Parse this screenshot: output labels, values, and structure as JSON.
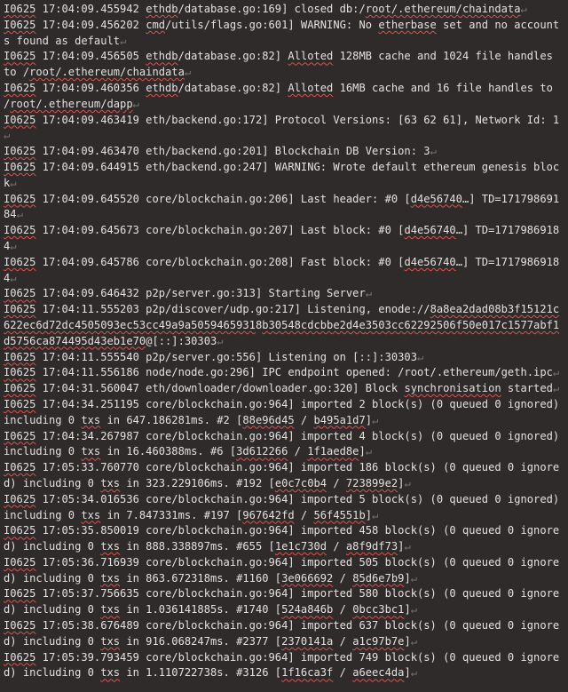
{
  "paragraph_marker": "↵",
  "line_break_marker": "↵",
  "underline_tokens": [
    "I0625",
    "ethdb",
    "cmd",
    "etherbase",
    "Alloted",
    "root/.ethereum/chaindata",
    "root/.ethereum/dapp",
    "d4e56740",
    "8a8ea2dad08b3f15121c622ec6d72dc4505093ec53cc49a9a5059465931",
    "b30548cdcbbe2d4e",
    "3503cc62292506f50e017c1577abf1d5756ca874495d43eb1e70",
    "synchronisation",
    "txs",
    "88e96d45",
    "b495a1d7",
    "3d612266",
    "1f1aed8e",
    "e0c7c0b4",
    "723899e2",
    "967642fd",
    "56f4551b",
    "1e1c730d",
    "a8f9df73",
    "3e066692",
    "85d6e7b9",
    "524a846b",
    "0bcc3bc1",
    "2370141a",
    "a1c97b7e",
    "1f16ca3f",
    "a6eec4da"
  ],
  "lines": [
    {
      "text": "I0625 17:04:09.455942 ethdb/database.go:169] closed db:/root/.ethereum/chaindata",
      "pmark": true
    },
    {
      "text": "I0625 17:04:09.456202 cmd/utils/flags.go:601] WARNING: No etherbase set and no accounts found as default",
      "pmark": true
    },
    {
      "text": "I0625 17:04:09.456505 ethdb/database.go:82] Alloted 128MB cache and 1024 file handles to /root/.ethereum/chaindata",
      "pmark": true
    },
    {
      "text": "I0625 17:04:09.460356 ethdb/database.go:82] Alloted 16MB cache and 16 file handles to /root/.ethereum/dapp",
      "pmark": true
    },
    {
      "text": "I0625 17:04:09.463419 eth/backend.go:172] Protocol Versions: [63 62 61], Network Id: 1",
      "pmark": true
    },
    {
      "text": "I0625 17:04:09.463470 eth/backend.go:201] Blockchain DB Version: 3",
      "pmark": true
    },
    {
      "text": "I0625 17:04:09.644915 eth/backend.go:247] WARNING: Wrote default ethereum genesis block",
      "pmark": true
    },
    {
      "text": "I0625 17:04:09.645520 core/blockchain.go:206] Last header: #0 [d4e56740…] TD=17179869184",
      "pmark": true
    },
    {
      "text": "I0625 17:04:09.645673 core/blockchain.go:207] Last block: #0 [d4e56740…] TD=17179869184",
      "pmark": true
    },
    {
      "text": "I0625 17:04:09.645786 core/blockchain.go:208] Fast block: #0 [d4e56740…] TD=17179869184",
      "pmark": true
    },
    {
      "text": "I0625 17:04:09.646432 p2p/server.go:313] Starting Server",
      "pmark": true
    },
    {
      "text": "I0625 17:04:11.555203 p2p/discover/udp.go:217] Listening, enode://8a8ea2dad08b3f15121c622ec6d72dc4505093ec53cc49a9a50594659318b30548cdcbbe2d4e3503cc62292506f50e017c1577abf1d5756ca874495d43eb1e70@[::]:30303",
      "pmark": true
    },
    {
      "text": "I0625 17:04:11.555540 p2p/server.go:556] Listening on [::]:30303",
      "pmark": true
    },
    {
      "text": "I0625 17:04:11.556186 node/node.go:296] IPC endpoint opened: /root/.ethereum/geth.ipc",
      "pmark": true
    },
    {
      "text": "I0625 17:04:31.560047 eth/downloader/downloader.go:320] Block synchronisation started",
      "pmark": true
    },
    {
      "text": "I0625 17:04:34.251195 core/blockchain.go:964] imported 2 block(s) (0 queued 0 ignored) including 0 txs in 647.186281ms. #2 [88e96d45 / b495a1d7]",
      "pmark": true
    },
    {
      "text": "I0625 17:04:34.267987 core/blockchain.go:964] imported 4 block(s) (0 queued 0 ignored) including 0 txs in 16.460388ms. #6 [3d612266 / 1f1aed8e]",
      "pmark": true
    },
    {
      "text": "I0625 17:05:33.760770 core/blockchain.go:964] imported 186 block(s) (0 queued 0 ignored) including 0 txs in 323.229106ms. #192 [e0c7c0b4 / 723899e2]",
      "pmark": true
    },
    {
      "text": "I0625 17:05:34.016536 core/blockchain.go:964] imported 5 block(s) (0 queued 0 ignored) including 0 txs in 7.847331ms. #197 [967642fd / 56f4551b]",
      "pmark": true
    },
    {
      "text": "I0625 17:05:35.850019 core/blockchain.go:964] imported 458 block(s) (0 queued 0 ignored) including 0 txs in 888.338897ms. #655 [1e1c730d / a8f9df73]",
      "pmark": true
    },
    {
      "text": "I0625 17:05:36.716939 core/blockchain.go:964] imported 505 block(s) (0 queued 0 ignored) including 0 txs in 863.672318ms. #1160 [3e066692 / 85d6e7b9]",
      "pmark": true
    },
    {
      "text": "I0625 17:05:37.756635 core/blockchain.go:964] imported 580 block(s) (0 queued 0 ignored) including 0 txs in 1.036141885s. #1740 [524a846b / 0bcc3bc1]",
      "pmark": true
    },
    {
      "text": "I0625 17:05:38.676489 core/blockchain.go:964] imported 637 block(s) (0 queued 0 ignored) including 0 txs in 916.068247ms. #2377 [2370141a / a1c97b7e]",
      "pmark": true
    },
    {
      "text": "I0625 17:05:39.793459 core/blockchain.go:964] imported 749 block(s) (0 queued 0 ignored) including 0 txs in 1.110722738s. #3126 [1f16ca3f / a6eec4da]",
      "pmark": true
    }
  ]
}
